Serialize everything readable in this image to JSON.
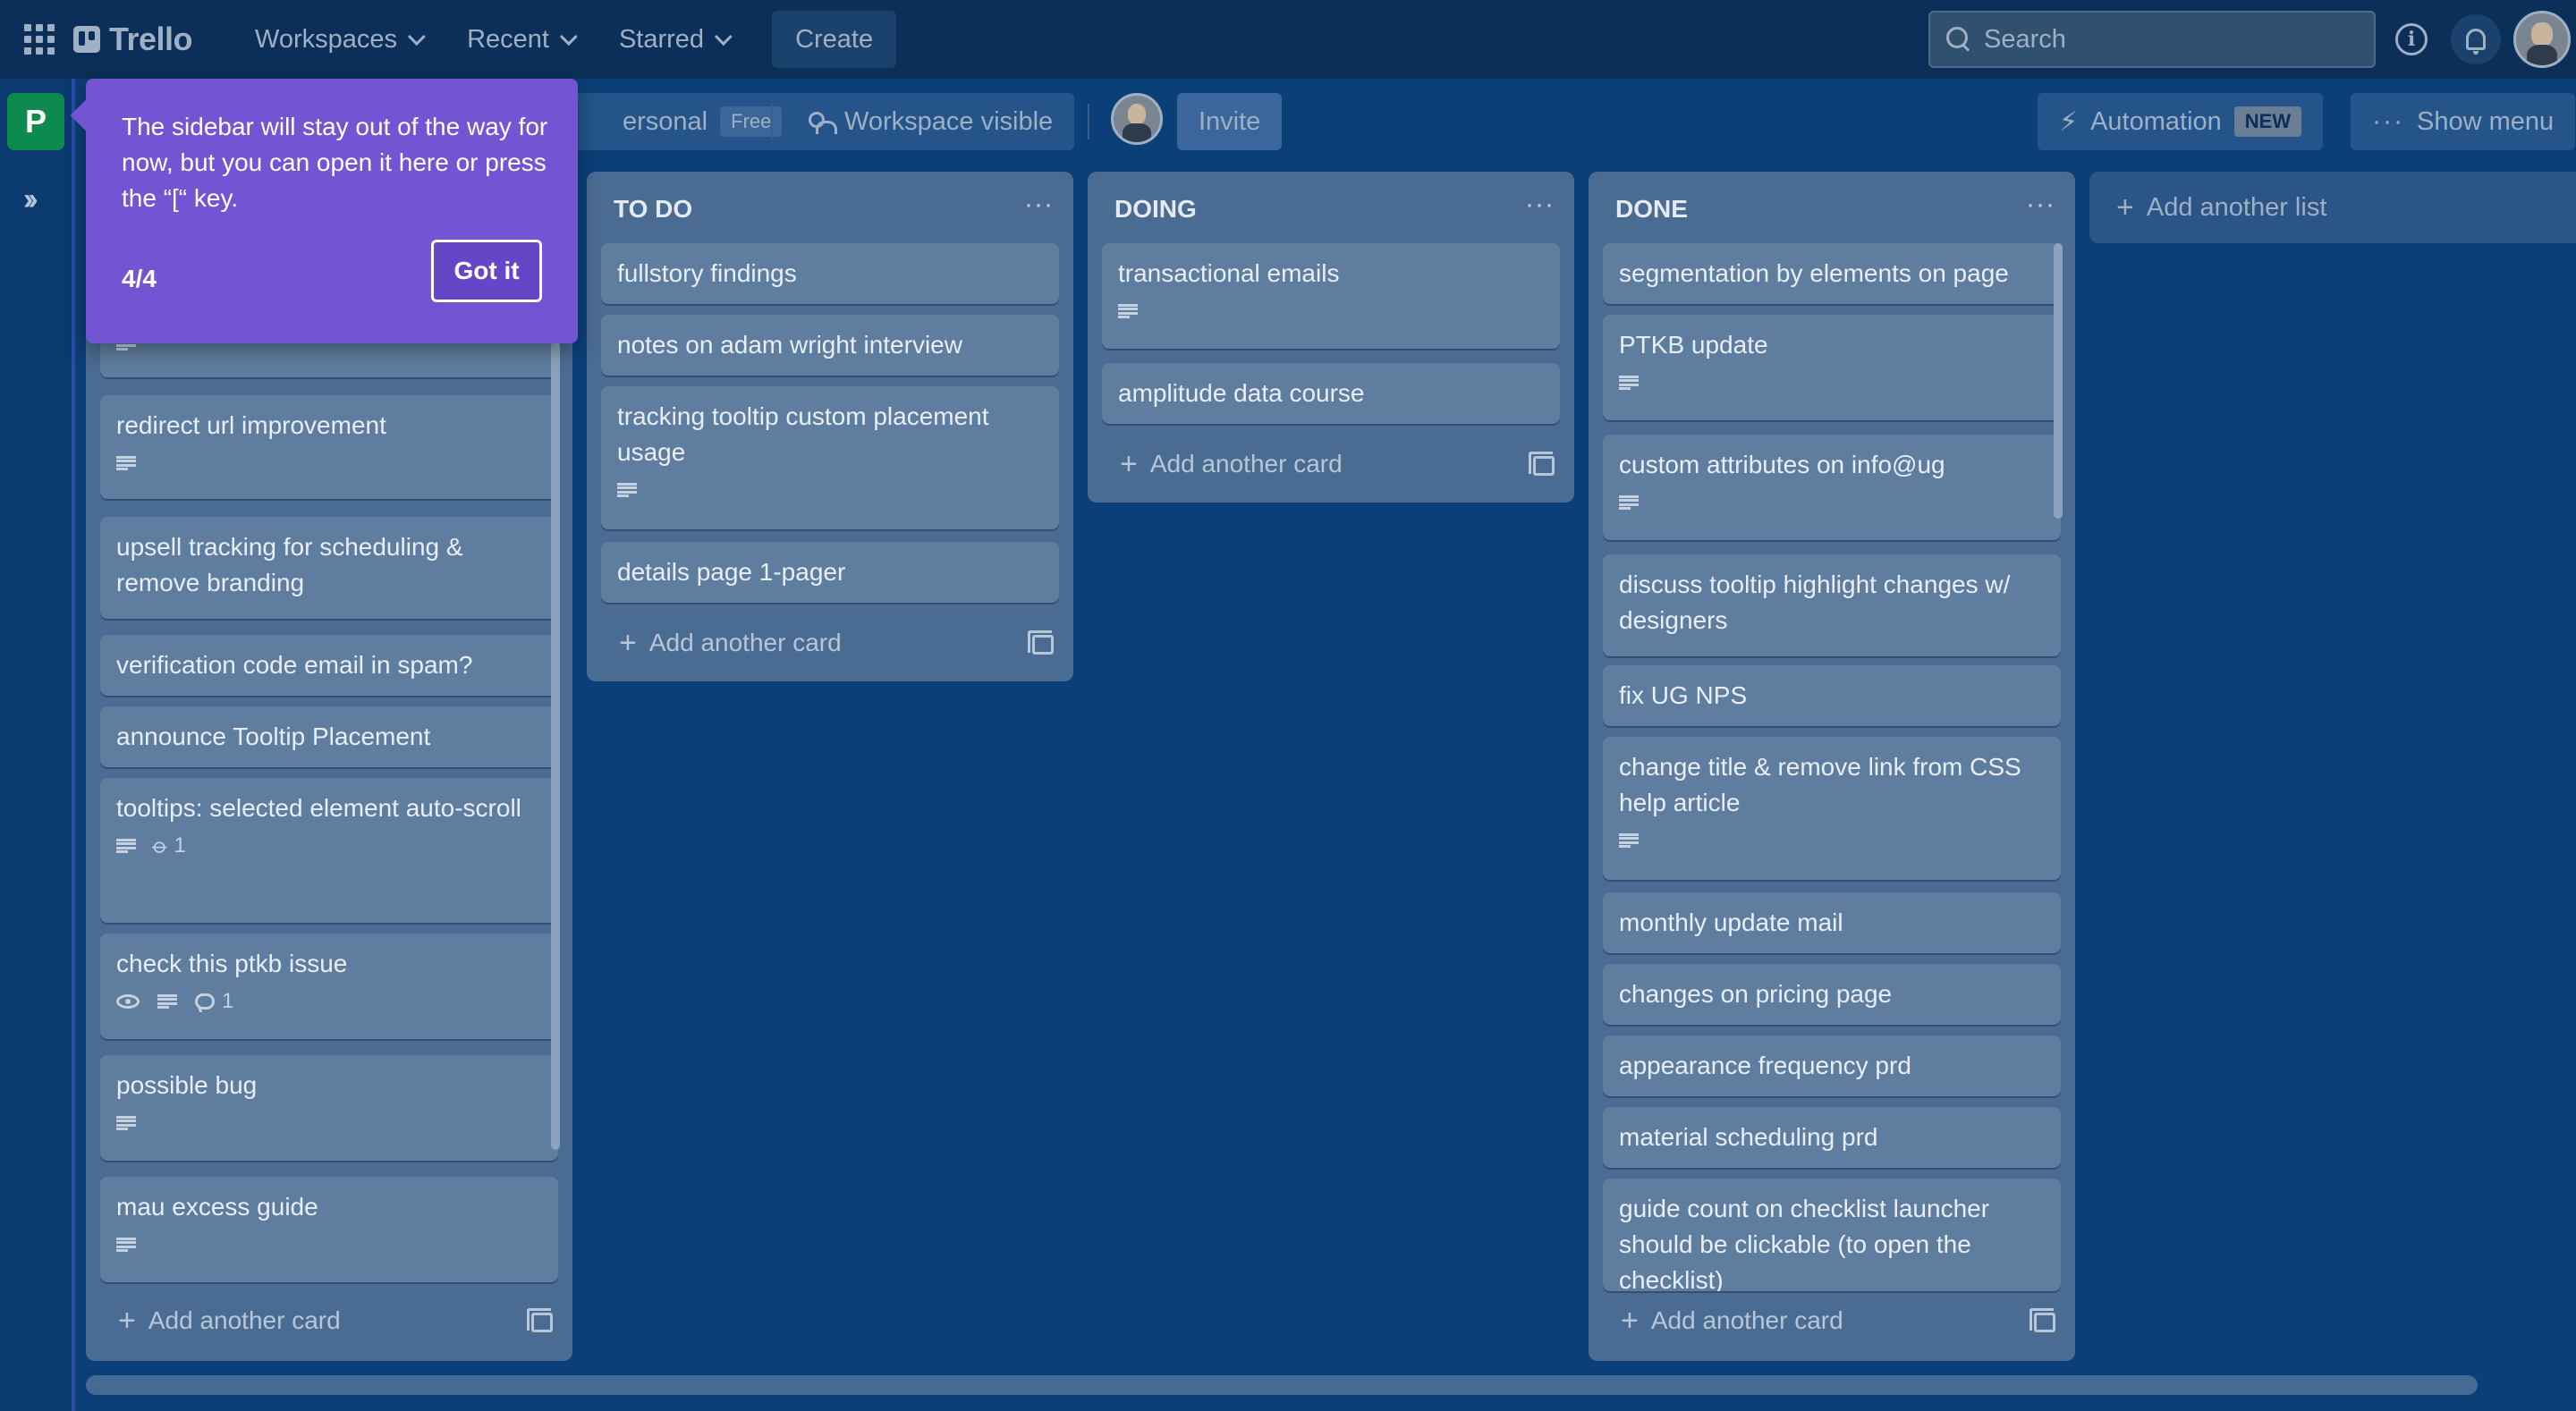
{
  "topnav": {
    "logo_text": "Trello",
    "workspaces": "Workspaces",
    "recent": "Recent",
    "starred": "Starred",
    "create": "Create",
    "search_placeholder": "Search",
    "info_glyph": "i"
  },
  "rail": {
    "workspace_initial": "P",
    "expand_glyph": "››"
  },
  "board_header": {
    "workspace_name": "ersonal",
    "workspace_plan": "Free",
    "visibility": "Workspace visible",
    "invite": "Invite",
    "automation": "Automation",
    "automation_badge": "NEW",
    "show_menu": "Show menu"
  },
  "lists": {
    "backlog": {
      "cards": [
        {
          "title": "redirect url improvement"
        },
        {
          "title": "upsell tracking for scheduling & remove branding"
        },
        {
          "title": "verification code email in spam?"
        },
        {
          "title": "announce Tooltip Placement"
        },
        {
          "title": "tooltips: selected element auto-scroll",
          "attachments": "1"
        },
        {
          "title": "check this ptkb issue",
          "comments": "1"
        },
        {
          "title": "possible bug"
        },
        {
          "title": "mau excess guide"
        }
      ],
      "add_card": "Add another card"
    },
    "todo": {
      "title": "TO DO",
      "menu": "···",
      "cards": [
        {
          "title": "fullstory findings"
        },
        {
          "title": "notes on adam wright interview"
        },
        {
          "title": "tracking tooltip custom placement usage"
        },
        {
          "title": "details page 1-pager"
        }
      ],
      "add_card": "Add another card"
    },
    "doing": {
      "title": "DOING",
      "menu": "···",
      "cards": [
        {
          "title": "transactional emails"
        },
        {
          "title": "amplitude data course"
        }
      ],
      "add_card": "Add another card"
    },
    "done": {
      "title": "DONE",
      "menu": "···",
      "cards": [
        {
          "title": "segmentation by elements on page"
        },
        {
          "title": "PTKB update"
        },
        {
          "title": "custom attributes on info@ug"
        },
        {
          "title": "discuss tooltip highlight changes w/ designers"
        },
        {
          "title": "fix UG NPS"
        },
        {
          "title": "change title & remove link from CSS help article"
        },
        {
          "title": "monthly update mail"
        },
        {
          "title": "changes on pricing page"
        },
        {
          "title": "appearance frequency prd"
        },
        {
          "title": "material scheduling prd"
        },
        {
          "title": "guide count on checklist launcher should be clickable (to open the checklist)"
        }
      ],
      "add_card": "Add another card"
    }
  },
  "add_list": "Add another list",
  "tooltip": {
    "text": "The sidebar will stay out of the way for now, but you can open it here or press the “[“ key.",
    "step": "4/4",
    "button": "Got it"
  },
  "colors": {
    "tooltip_bg": "#7355d4",
    "workspace_badge": "#0d8a4e",
    "board_bg": "#0b3f77"
  }
}
